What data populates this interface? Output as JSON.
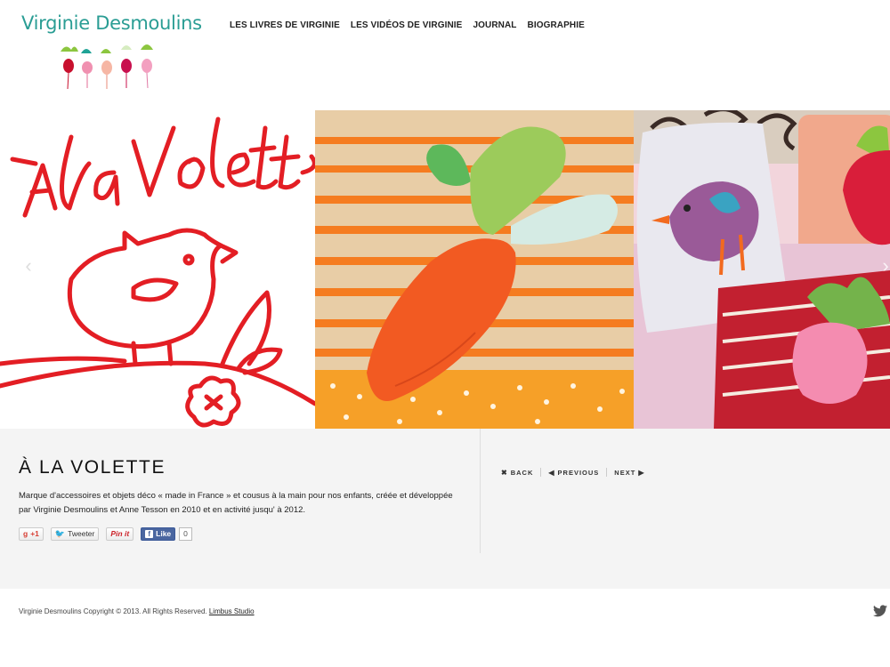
{
  "site": {
    "logo_text": "Virginie Desmoulins"
  },
  "nav": {
    "items": [
      {
        "label": "LES LIVRES DE VIRGINIE"
      },
      {
        "label": "LES VIDÉOS DE VIRGINIE"
      },
      {
        "label": "JOURNAL"
      },
      {
        "label": "BIOGRAPHIE"
      }
    ]
  },
  "slider": {
    "slide1_title_art": "À la Volette"
  },
  "project": {
    "title": "À LA VOLETTE",
    "description": "Marque d'accessoires et objets déco « made in France » et cousus à la main pour nos enfants, créée et développée par Virginie Desmoulins et Anne Tesson en 2010 et en activité jusqu' à 2012."
  },
  "social": {
    "gplus_label": "+1",
    "tweet_label": "Tweeter",
    "pin_label": "Pin it",
    "like_label": "Like",
    "like_count": "0"
  },
  "pager": {
    "back_label": "BACK",
    "previous_label": "PREVIOUS",
    "next_label": "NEXT"
  },
  "footer": {
    "copyright": "Virginie Desmoulins Copyright © 2013. All Rights Reserved.",
    "studio_link": "Limbus Studio"
  },
  "colors": {
    "logo": "#2a9d94",
    "art_red": "#e31e24",
    "panel_bg": "#f4f4f4"
  }
}
